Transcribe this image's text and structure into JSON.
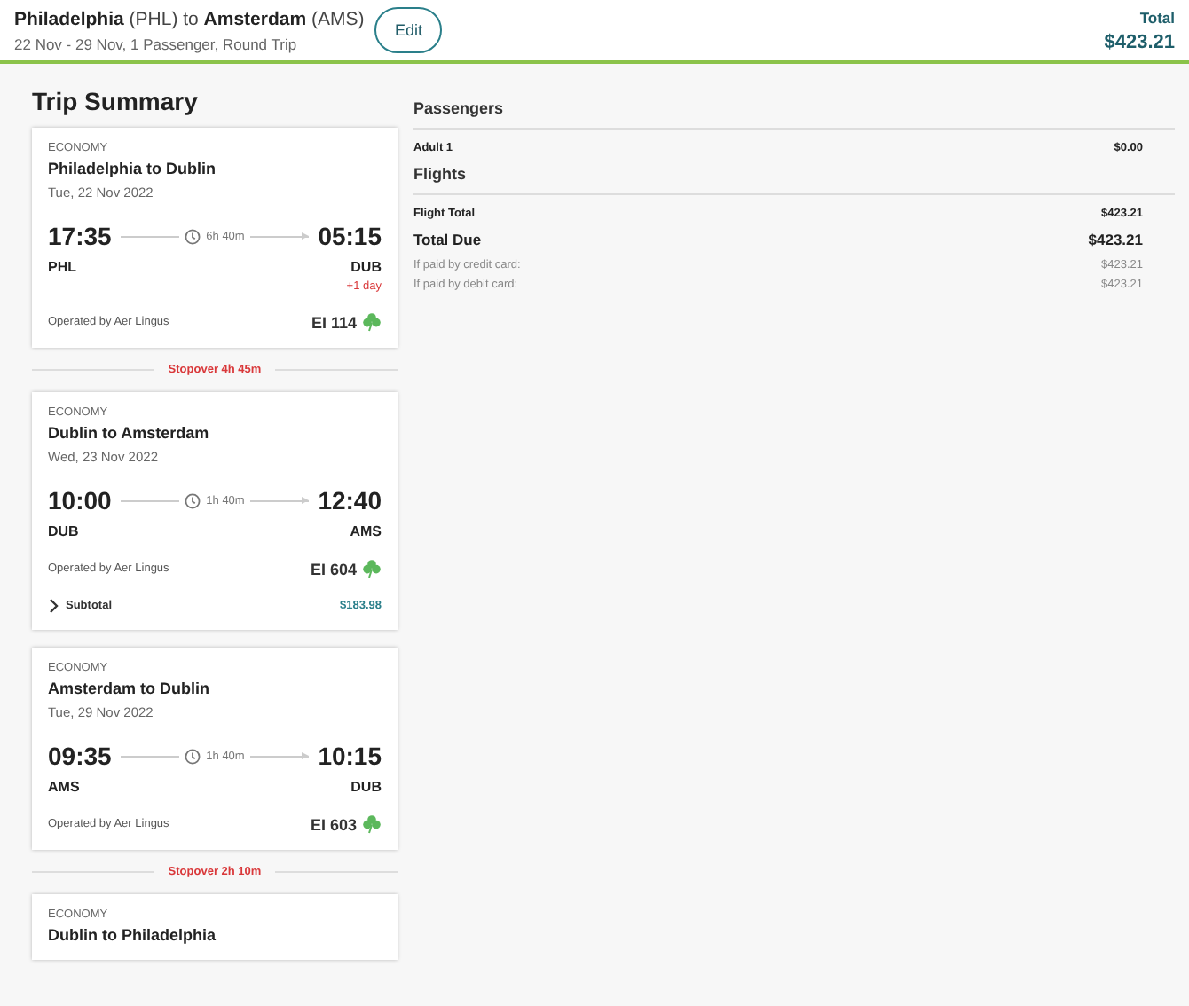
{
  "header": {
    "title": "**Philadelphia** (PHL) to **Amsterdam** (AMS)",
    "subtitle": "22 Nov - 29 Nov, 1 Passenger, Round Trip",
    "edit_button": "Edit",
    "total_label": "Total",
    "total_amount": "$423.21"
  },
  "trip_summary": {
    "title": "Trip Summary",
    "segments": [
      {
        "kind": "leg",
        "cabin": "ECONOMY",
        "route": "Philadelphia to Dublin",
        "date": "Tue, 22 Nov 2022",
        "depart_time": "17:35",
        "arrive_time": "05:15",
        "duration": "6h 40m",
        "from": "PHL",
        "to": "DUB",
        "day_offset": "+1 day",
        "operator": "Operated by Aer Lingus",
        "flight_number": "EI 114"
      },
      {
        "kind": "stopover",
        "text": "Stopover 4h 45m"
      },
      {
        "kind": "leg",
        "cabin": "ECONOMY",
        "route": "Dublin to Amsterdam",
        "date": "Wed, 23 Nov 2022",
        "depart_time": "10:00",
        "arrive_time": "12:40",
        "duration": "1h 40m",
        "from": "DUB",
        "to": "AMS",
        "operator": "Operated by Aer Lingus",
        "flight_number": "EI 604",
        "subtotal_label": "Subtotal",
        "subtotal": "$183.98"
      },
      {
        "kind": "leg",
        "cabin": "ECONOMY",
        "route": "Amsterdam to Dublin",
        "date": "Tue, 29 Nov 2022",
        "depart_time": "09:35",
        "arrive_time": "10:15",
        "duration": "1h 40m",
        "from": "AMS",
        "to": "DUB",
        "operator": "Operated by Aer Lingus",
        "flight_number": "EI 603"
      },
      {
        "kind": "stopover",
        "text": "Stopover 2h 10m"
      },
      {
        "kind": "leg",
        "cabin": "ECONOMY",
        "route": "Dublin to Philadelphia"
      }
    ]
  },
  "price_sections": [
    {
      "title": "Passengers",
      "rows": [
        {
          "kind": "line",
          "label": "Adult 1",
          "amount": "$0.00"
        }
      ]
    },
    {
      "title": "Flights",
      "rows": [
        {
          "kind": "line",
          "label": "Flight Total",
          "amount": "$423.21"
        },
        {
          "kind": "total",
          "label": "Total Due",
          "amount": "$423.21"
        },
        {
          "kind": "note",
          "label": "If paid by credit card:",
          "amount": "$423.21"
        },
        {
          "kind": "note",
          "label": "If paid by debit card:",
          "amount": "$423.21"
        }
      ]
    }
  ]
}
